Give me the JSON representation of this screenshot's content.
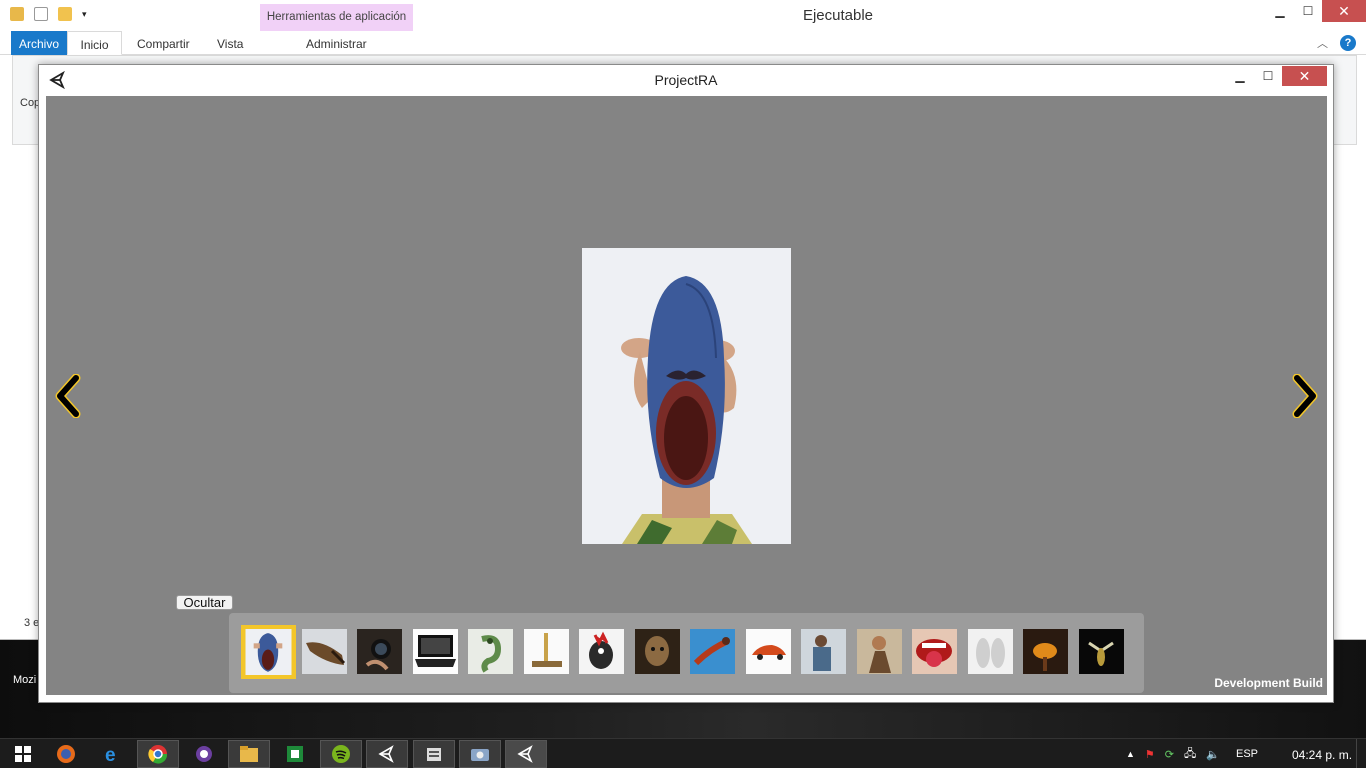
{
  "explorer": {
    "title": "Ejecutable",
    "tool_tab": "Herramientas de aplicación",
    "tabs": [
      "Archivo",
      "Inicio",
      "Compartir",
      "Vista",
      "Administrar"
    ],
    "left_partial": "Cop",
    "status_partial": "3 e",
    "taskbar_partial": "Mozi"
  },
  "player": {
    "title": "ProjectRA",
    "hide_button": "Ocultar",
    "dev_build": "Development Build",
    "selected_thumbnail_index": 0,
    "thumbnails": [
      {
        "icon": "shoe-face-thumbnail"
      },
      {
        "icon": "boot-thumbnail"
      },
      {
        "icon": "camera-lens-thumbnail"
      },
      {
        "icon": "laptop-thumbnail"
      },
      {
        "icon": "chameleon-thumbnail"
      },
      {
        "icon": "tool-thumbnail"
      },
      {
        "icon": "rooster-thumbnail"
      },
      {
        "icon": "face-thumbnail"
      },
      {
        "icon": "bird-thumbnail"
      },
      {
        "icon": "red-car-thumbnail"
      },
      {
        "icon": "person-thumbnail"
      },
      {
        "icon": "woman-thumbnail"
      },
      {
        "icon": "mouth-thumbnail"
      },
      {
        "icon": "slippers-thumbnail"
      },
      {
        "icon": "lamp-thumbnail"
      },
      {
        "icon": "insect-thumbnail"
      }
    ]
  },
  "taskbar": {
    "language": "ESP",
    "clock": "04:24 p. m.",
    "apps": [
      "windows-start-icon",
      "firefox-icon",
      "internet-explorer-icon",
      "chrome-icon",
      "app-circle-icon",
      "file-explorer-icon",
      "spreadsheet-icon",
      "spotify-icon",
      "unity-icon",
      "media-icon",
      "gear-folder-icon",
      "unity-active-icon"
    ]
  },
  "colors": {
    "viewport_bg": "#848484",
    "thumb_bar_bg": "#9c9c9c",
    "selection": "#f3c62a",
    "close_red": "#c75050",
    "ribbon_blue": "#1979ca"
  }
}
